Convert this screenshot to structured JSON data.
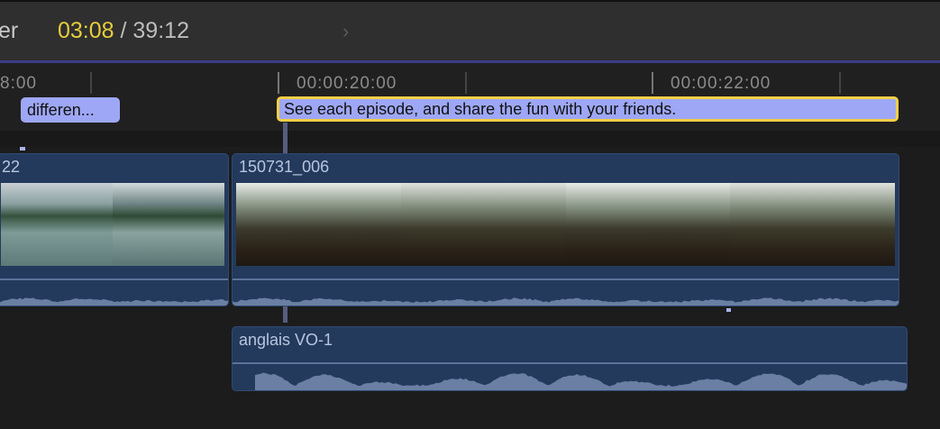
{
  "topbar": {
    "label_fragment": "er",
    "current_time": "03:08",
    "separator": " / ",
    "total_time": "39:12",
    "chevron": "›"
  },
  "ruler": {
    "labels": [
      "8:00",
      "00:00:20:00",
      "00:00:22:00"
    ]
  },
  "captions": [
    {
      "text": "differen..."
    },
    {
      "text": "See each episode,  and share the fun with your friends."
    }
  ],
  "clips": {
    "left": {
      "name": "22"
    },
    "main": {
      "name": "150731_006"
    },
    "audio": {
      "name": "anglais VO-1"
    }
  },
  "colors": {
    "playhead_timecode": "#e6cd3c",
    "caption": "#9ea7f5",
    "selection": "#f3cf45",
    "clip": "#243a5c"
  }
}
